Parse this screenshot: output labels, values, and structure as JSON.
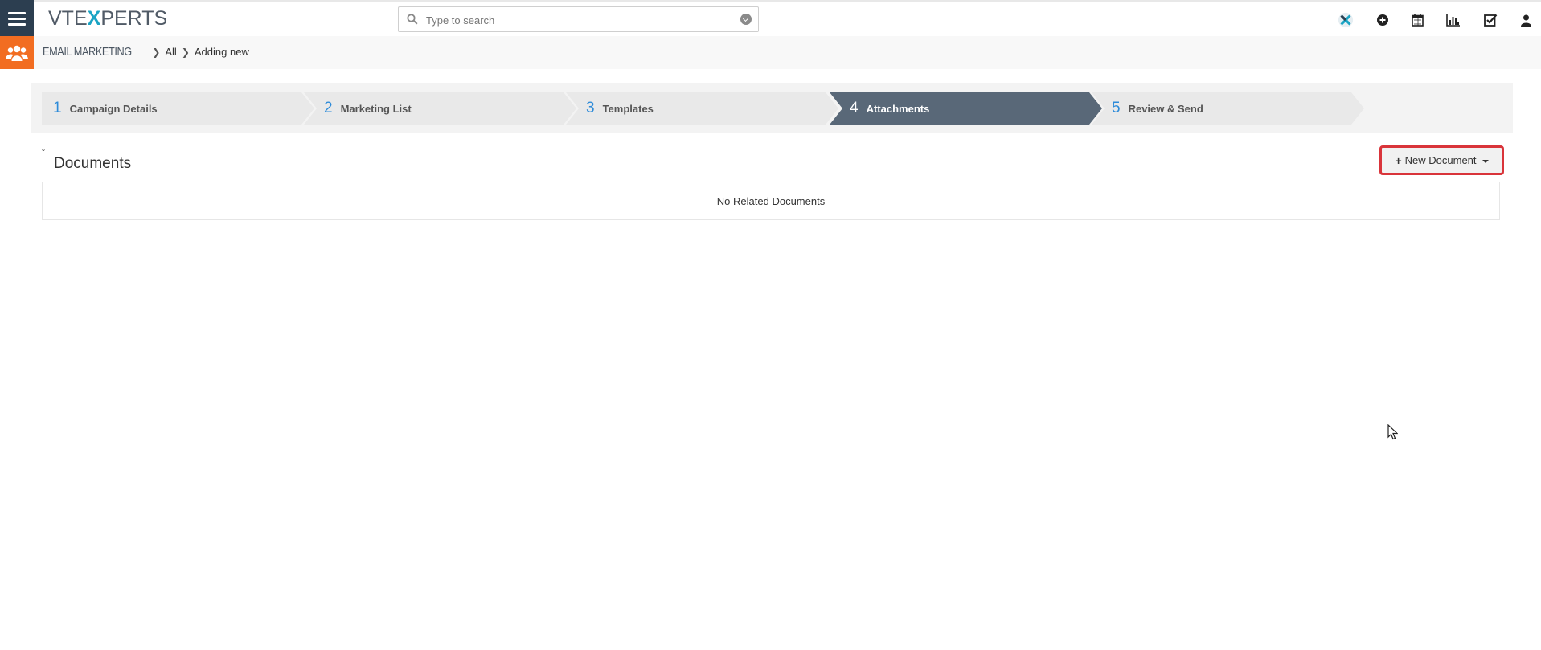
{
  "brand": {
    "logo_pre": "VTE",
    "logo_x": "X",
    "logo_post": "PERTS"
  },
  "search": {
    "placeholder": "Type to search"
  },
  "top_icons": [
    "vtexperts-icon",
    "add-icon",
    "calendar-icon",
    "reports-icon",
    "tasks-icon",
    "user-icon"
  ],
  "breadcrumb": {
    "module": "EMAIL MARKETING",
    "level1": "All",
    "level2": "Adding new"
  },
  "wizard": {
    "steps": [
      {
        "num": "1",
        "label": "Campaign Details",
        "active": false
      },
      {
        "num": "2",
        "label": "Marketing List",
        "active": false
      },
      {
        "num": "3",
        "label": "Templates",
        "active": false
      },
      {
        "num": "4",
        "label": "Attachments",
        "active": true
      },
      {
        "num": "5",
        "label": "Review & Send",
        "active": false
      }
    ]
  },
  "documents": {
    "title": "Documents",
    "toggle": "ˇ",
    "new_button_plus": "+",
    "new_button_label": "New Document",
    "empty_text": "No Related Documents"
  },
  "colors": {
    "brand_dark": "#2c3e50",
    "accent_orange": "#f26d21",
    "step_active": "#596878",
    "step_num": "#2d8bd9",
    "highlight_red": "#d9343a"
  }
}
